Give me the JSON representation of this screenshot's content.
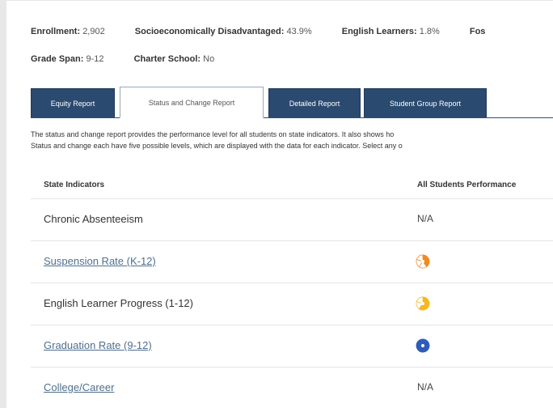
{
  "meta": {
    "row1": [
      {
        "label": "Enrollment:",
        "value": "2,902"
      },
      {
        "label": "Socioeconomically Disadvantaged:",
        "value": "43.9%"
      },
      {
        "label": "English Learners:",
        "value": "1.8%"
      },
      {
        "label": "Fos",
        "value": ""
      }
    ],
    "row2": [
      {
        "label": "Grade Span:",
        "value": "9-12"
      },
      {
        "label": "Charter School:",
        "value": "No"
      }
    ]
  },
  "tabs": [
    {
      "label": "Equity Report",
      "active": false
    },
    {
      "label": "Status and Change Report",
      "active": true
    },
    {
      "label": "Detailed Report",
      "active": false
    },
    {
      "label": "Student Group Report",
      "active": false
    }
  ],
  "description": {
    "line1": "The status and change report provides the performance level for all students on state indicators. It also shows ho",
    "line2": "Status and change each have five possible levels, which are displayed with the data for each indicator. Select any o"
  },
  "table": {
    "headers": {
      "indicator": "State Indicators",
      "performance": "All Students Performance"
    },
    "rows": [
      {
        "indicator": "Chronic Absenteeism",
        "link": false,
        "performance": "N/A",
        "level": null,
        "color": null
      },
      {
        "indicator": "Suspension Rate (K-12)",
        "link": true,
        "performance": "",
        "level": 2,
        "color": "#f08a24"
      },
      {
        "indicator": "English Learner Progress (1-12)",
        "link": false,
        "performance": "",
        "level": 3,
        "color": "#f5b81f"
      },
      {
        "indicator": "Graduation Rate (9-12)",
        "link": true,
        "performance": "",
        "level": 5,
        "color": "#2e5cb8"
      },
      {
        "indicator": "College/Career",
        "link": true,
        "performance": "N/A",
        "level": null,
        "color": null
      }
    ]
  }
}
